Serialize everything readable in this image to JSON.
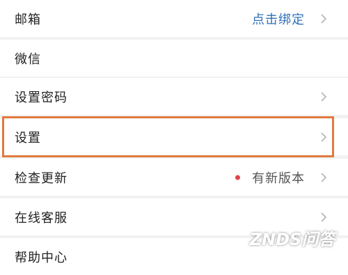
{
  "colors": {
    "accent_blue": "#2c6fb7",
    "highlight_border": "#e07a3e",
    "new_version_dot": "#e2434b",
    "chevron": "#b3b3b3",
    "separator": "#f2f2f2"
  },
  "settings_list": {
    "items": [
      {
        "label": "邮箱",
        "value": "点击绑定",
        "value_style": "link",
        "icon": "chevron-right-icon"
      },
      {
        "label": "微信",
        "value": "",
        "icon": ""
      },
      {
        "label": "设置密码",
        "value": "",
        "icon": "chevron-right-icon"
      },
      {
        "label": "设置",
        "value": "",
        "icon": "chevron-right-icon",
        "highlighted": true
      },
      {
        "label": "检查更新",
        "value": "有新版本",
        "value_style": "muted",
        "badge": "red-dot-icon",
        "icon": "chevron-right-icon"
      },
      {
        "label": "在线客服",
        "value": "",
        "icon": "chevron-right-icon"
      },
      {
        "label": "帮助中心",
        "value": "",
        "icon": ""
      }
    ]
  },
  "watermark": {
    "text": "ZNDS问答"
  }
}
